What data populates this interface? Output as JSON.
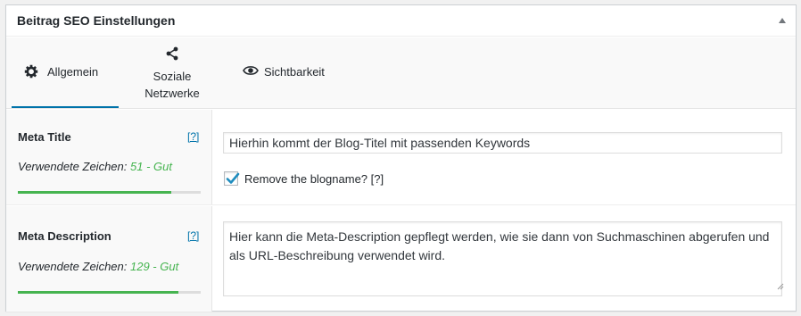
{
  "metabox": {
    "title": "Beitrag SEO Einstellungen",
    "toggle_icon": "triangle-up-icon"
  },
  "tabs": [
    {
      "label": "Allgemein",
      "icon": "gear-icon",
      "active": true
    },
    {
      "label_line1": "Soziale",
      "label_line2": "Netzwerke",
      "icon": "share-icon",
      "active": false
    },
    {
      "label": "Sichtbarkeit",
      "icon": "eye-icon",
      "active": false
    }
  ],
  "meta_title": {
    "label": "Meta Title",
    "help": "[?]",
    "counter_prefix": "Verwendete Zeichen:",
    "counter_value": "51 - Gut",
    "progress": 0.84,
    "input_value": "Hierhin kommt der Blog-Titel mit passenden Keywords",
    "checkbox_checked": true,
    "checkbox_label": "Remove the blogname? [?]"
  },
  "meta_description": {
    "label": "Meta Description",
    "help": "[?]",
    "counter_prefix": "Verwendete Zeichen:",
    "counter_value": "129 - Gut",
    "progress": 0.88,
    "textarea_value": "Hier kann die Meta-Description gepflegt werden, wie sie dann von Suchmaschinen abgerufen und als URL-Beschreibung verwendet wird."
  },
  "colors": {
    "accent": "#0073aa",
    "good": "#46b450"
  }
}
